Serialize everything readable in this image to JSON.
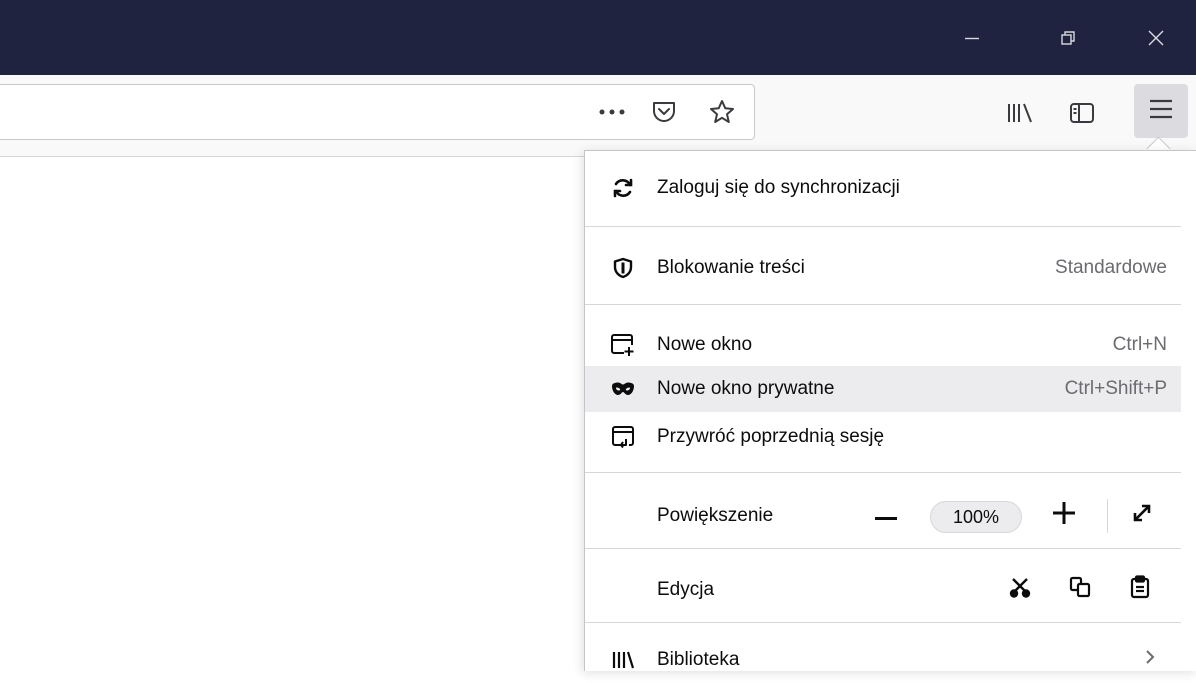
{
  "window_controls": {
    "minimize_icon": "minimize-icon",
    "restore_icon": "restore-icon",
    "close_icon": "close-icon"
  },
  "toolbar": {
    "page_actions_icon": "more-dots-icon",
    "pocket_icon": "pocket-icon",
    "bookmark_icon": "star-icon",
    "library_icon": "library-icon",
    "sidebar_icon": "sidebar-icon",
    "menu_icon": "hamburger-icon"
  },
  "menu": {
    "sync_label": "Zaloguj się do synchronizacji",
    "content_blocking_label": "Blokowanie treści",
    "content_blocking_value": "Standardowe",
    "new_window_label": "Nowe okno",
    "new_window_shortcut": "Ctrl+N",
    "private_window_label": "Nowe okno prywatne",
    "private_window_shortcut": "Ctrl+Shift+P",
    "restore_session_label": "Przywróć poprzednią sesję",
    "zoom_label": "Powiększenie",
    "zoom_value": "100%",
    "edit_label": "Edycja",
    "library_label": "Biblioteka"
  },
  "colors": {
    "titlebar": "#202340",
    "toolbar": "#f9f9fa",
    "hover": "#ececee"
  }
}
